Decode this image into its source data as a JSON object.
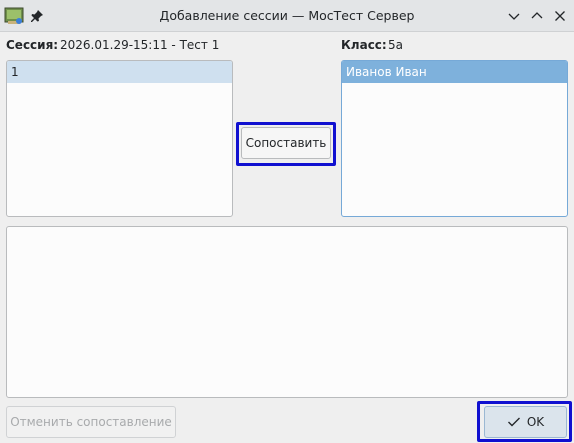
{
  "window": {
    "title": "Добавление сессии — МосТест Сервер",
    "icons": {
      "app": "app-icon",
      "pin": "pin-icon",
      "minimize": "chevron-down-icon",
      "maximize": "chevron-up-icon",
      "close": "close-icon"
    }
  },
  "session": {
    "label": "Сессия:",
    "value": "2026.01.29-15:11 - Тест 1",
    "items": [
      "1"
    ]
  },
  "class_info": {
    "label": "Класс:",
    "value": "5а",
    "students": [
      "Иванов Иван"
    ]
  },
  "buttons": {
    "match": "Сопоставить",
    "cancel_match": "Отменить сопоставление",
    "ok": "OK"
  },
  "colors": {
    "highlight_border": "#1010d0",
    "selection_light": "#cfe0ef",
    "selection_strong": "#7eb1dc"
  }
}
